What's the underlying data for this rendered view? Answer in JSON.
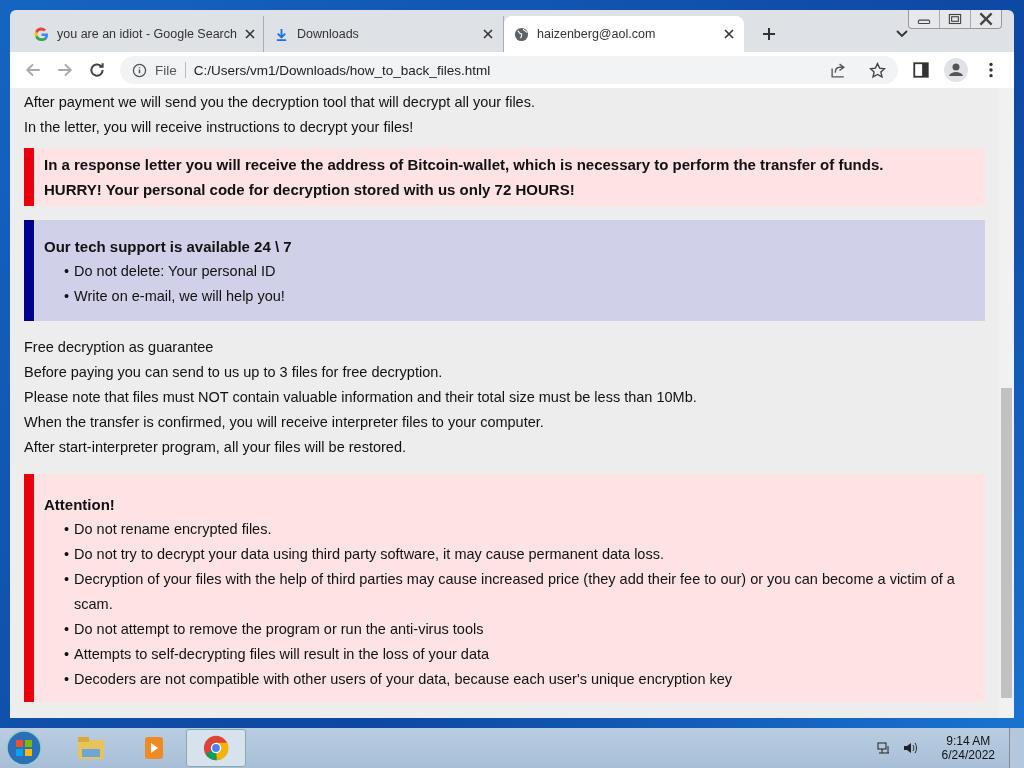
{
  "browser": {
    "tabs": [
      {
        "title": "you are an idiot - Google Search",
        "kind": "google",
        "selected": false
      },
      {
        "title": "Downloads",
        "kind": "download",
        "selected": false
      },
      {
        "title": "haizenberg@aol.com",
        "kind": "globe",
        "selected": true
      }
    ],
    "address": {
      "scheme": "File",
      "url": "C:/Users/vm1/Downloads/how_to_back_files.html"
    }
  },
  "page": {
    "intro": [
      "After payment we will send you the decryption tool that will decrypt all your files.",
      "In the letter, you will receive instructions to decrypt your files!"
    ],
    "boxes": [
      {
        "kind": "alert",
        "lines": [
          "In a response letter you will receive the address of Bitcoin-wallet, which is necessary to perform the transfer of funds.",
          "HURRY! Your personal code for decryption stored with us only 72 HOURS!"
        ]
      },
      {
        "kind": "info",
        "marker": "•",
        "heading": "Our tech support is available 24 \\ 7",
        "items": [
          "Do not delete: Your personal ID",
          "Write on e-mail, we will help you!"
        ]
      }
    ],
    "free": [
      "Free decryption as guarantee",
      "Before paying you can send to us up to 3 files for free decryption.",
      "Please note that files must NOT contain valuable information and their total size must be less than 10Mb.",
      "When the transfer is confirmed, you will receive interpreter files to your computer.",
      "After start-interpreter program, all your files will be restored."
    ],
    "attention": {
      "kind": "warning",
      "marker": "•",
      "heading": "Attention!",
      "items": [
        "Do not rename encrypted files.",
        "Do not try to decrypt your data using third party software, it may cause permanent data loss.",
        "Decryption of your files with the help of third parties may cause increased price (they add their fee to our) or you can become a victim of a scam.",
        "Do not attempt to remove the program or run the anti-virus tools",
        "Attempts to self-decrypting files will result in the loss of your data",
        "Decoders are not compatible with other users of your data, because each user's unique encryption key"
      ]
    }
  },
  "taskbar": {
    "apps": [
      {
        "kind": "explorer",
        "selected": false
      },
      {
        "kind": "media",
        "selected": false
      },
      {
        "kind": "chrome",
        "selected": true
      }
    ],
    "time": "9:14 AM",
    "date": "6/24/2022"
  }
}
